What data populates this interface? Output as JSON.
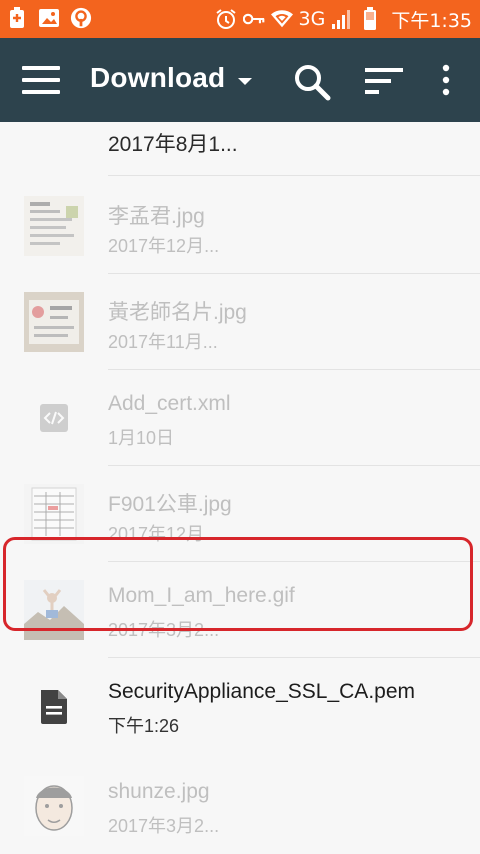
{
  "status_bar": {
    "network_label": "3G",
    "time": "下午1:35"
  },
  "app_bar": {
    "title": "Download",
    "icons": [
      "menu-icon",
      "caret-down-icon",
      "search-icon",
      "sort-icon",
      "more-vert-icon"
    ]
  },
  "files": [
    {
      "name": "",
      "date": "2017年8月1...",
      "icon": "folder-icon"
    },
    {
      "name": "李孟君.jpg",
      "date": "2017年12月...",
      "icon": "image-thumbnail"
    },
    {
      "name": "黃老師名片.jpg",
      "date": "2017年11月...",
      "icon": "image-thumbnail"
    },
    {
      "name": "Add_cert.xml",
      "date": "1月10日",
      "icon": "code-file-icon"
    },
    {
      "name": "F901公車.jpg",
      "date": "2017年12月...",
      "icon": "image-thumbnail"
    },
    {
      "name": "Mom_I_am_here.gif",
      "date": "2017年3月2...",
      "icon": "image-thumbnail"
    },
    {
      "name": "SecurityAppliance_SSL_CA.pem",
      "date": "下午1:26",
      "icon": "document-icon"
    },
    {
      "name": "shunze.jpg",
      "date": "2017年3月2...",
      "icon": "image-thumbnail"
    }
  ],
  "colors": {
    "status_bar": "#f3641e",
    "app_bar": "#2d434d",
    "highlight": "#d7262b"
  }
}
